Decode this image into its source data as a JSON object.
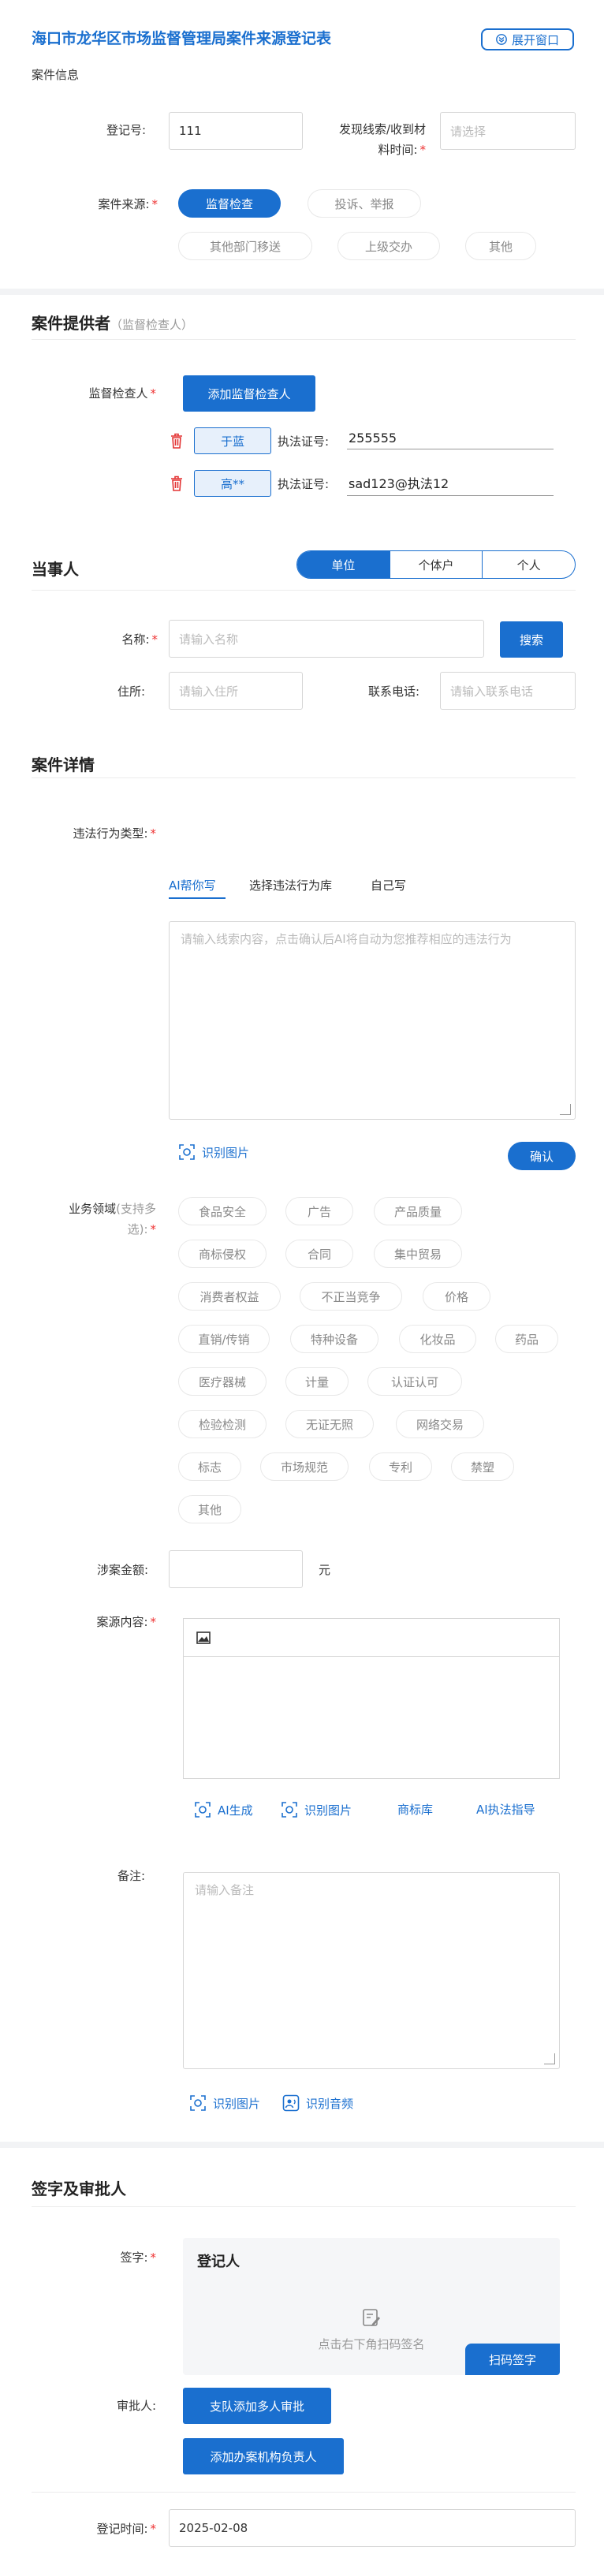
{
  "header": {
    "title": "海口市龙华区市场监督管理局案件来源登记表",
    "expand_label": "展开窗口",
    "section_label": "案件信息"
  },
  "case_info": {
    "reg_no_label": "登记号:",
    "reg_no_value": "111",
    "discover_time_label_1": "发现线索/收到材",
    "discover_time_label_2": "料时间:",
    "discover_time_placeholder": "请选择",
    "source_label": "案件来源:",
    "sources": [
      "监督检查",
      "投诉、举报",
      "其他部门移送",
      "上级交办",
      "其他"
    ],
    "selected_source": "监督检查"
  },
  "provider": {
    "title": "案件提供者",
    "subtitle": "（监督检查人）",
    "inspector_label": "监督检查人",
    "add_button": "添加监督检查人",
    "cert_label": "执法证号:",
    "inspectors": [
      {
        "name": "于蓝",
        "cert": "255555"
      },
      {
        "name": "高**",
        "cert": "sad123@执法12"
      }
    ]
  },
  "party": {
    "title": "当事人",
    "types": [
      "单位",
      "个体户",
      "个人"
    ],
    "selected_type": "单位",
    "name_label": "名称:",
    "name_placeholder": "请输入名称",
    "search_button": "搜索",
    "address_label": "住所:",
    "address_placeholder": "请输入住所",
    "phone_label": "联系电话:",
    "phone_placeholder": "请输入联系电话"
  },
  "details": {
    "title": "案件详情",
    "violation_label": "违法行为类型:",
    "tabs": [
      "AI帮你写",
      "选择违法行为库",
      "自己写"
    ],
    "active_tab": "AI帮你写",
    "violation_placeholder": "请输入线索内容，点击确认后AI将自动为您推荐相应的违法行为",
    "recognize_image": "识别图片",
    "confirm_button": "确认",
    "domain_label_1": "业务领域",
    "domain_label_hint_1": "(支持多",
    "domain_label_hint_2": "选):",
    "domains": [
      "食品安全",
      "广告",
      "产品质量",
      "商标侵权",
      "合同",
      "集中贸易",
      "消费者权益",
      "不正当竞争",
      "价格",
      "直销/传销",
      "特种设备",
      "化妆品",
      "药品",
      "医疗器械",
      "计量",
      "认证认可",
      "检验检测",
      "无证无照",
      "网络交易",
      "标志",
      "市场规范",
      "专利",
      "禁塑",
      "其他"
    ],
    "amount_label": "涉案金额:",
    "amount_unit": "元",
    "content_label": "案源内容:",
    "content_actions": [
      "AI生成",
      "识别图片",
      "商标库",
      "AI执法指导"
    ],
    "remark_label": "备注:",
    "remark_placeholder": "请输入备注",
    "remark_actions": [
      "识别图片",
      "识别音频"
    ]
  },
  "signature": {
    "title": "签字及审批人",
    "sign_label": "签字:",
    "panel_title": "登记人",
    "panel_hint": "点击右下角扫码签名",
    "scan_button": "扫码签字",
    "approver_label": "审批人:",
    "approver_btn_1": "支队添加多人审批",
    "approver_btn_2": "添加办案机构负责人",
    "reg_time_label": "登记时间:",
    "reg_time_value": "2025-02-08"
  },
  "colors": {
    "primary": "#1a6fcf",
    "required": "#e33333",
    "delete": "#e33333"
  }
}
